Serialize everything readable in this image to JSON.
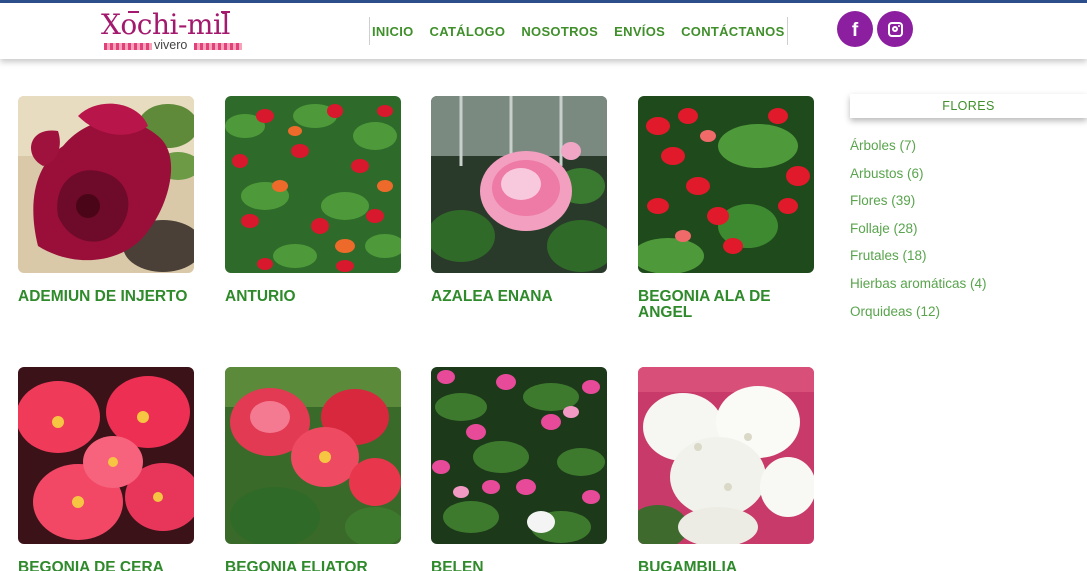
{
  "brand": {
    "name": "Xochi-mil",
    "subtitle": "vivero"
  },
  "nav": {
    "items": [
      {
        "label": "INICIO"
      },
      {
        "label": "CATÁLOGO"
      },
      {
        "label": "NOSOTROS"
      },
      {
        "label": "ENVÍOS"
      },
      {
        "label": "CONTÁCTANOS"
      }
    ]
  },
  "social": {
    "facebook_glyph": "f",
    "facebook_icon": "facebook-icon",
    "instagram_icon": "instagram-icon"
  },
  "products": [
    {
      "title": "ADEMIUN DE INJERTO"
    },
    {
      "title": "ANTURIO"
    },
    {
      "title": "AZALEA ENANA"
    },
    {
      "title": "BEGONIA ALA DE ANGEL"
    },
    {
      "title": "BEGONIA DE CERA"
    },
    {
      "title": "BEGONIA ELIATOR"
    },
    {
      "title": "BELEN"
    },
    {
      "title": "BUGAMBILIA"
    }
  ],
  "sidebar": {
    "title": "FLORES",
    "categories": [
      {
        "label": "Árboles (7)"
      },
      {
        "label": "Arbustos (6)"
      },
      {
        "label": "Flores (39)"
      },
      {
        "label": "Follaje (28)"
      },
      {
        "label": "Frutales (18)"
      },
      {
        "label": "Hierbas aromáticas (4)"
      },
      {
        "label": "Orquideas (12)"
      }
    ]
  },
  "colors": {
    "brand_magenta": "#a3196e",
    "nav_green": "#3f8f2a",
    "title_green": "#2e8a2a",
    "social_purple": "#8c1fa0",
    "top_line_blue": "#2d4f8c"
  }
}
